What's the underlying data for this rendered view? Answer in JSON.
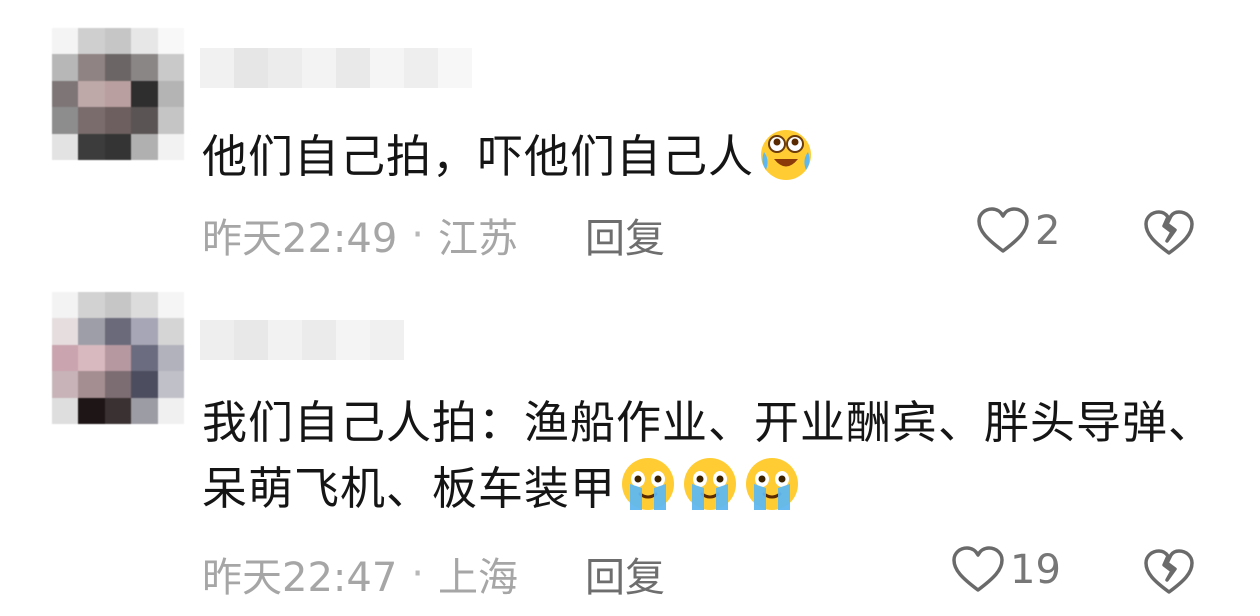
{
  "comments": [
    {
      "text": "他们自己拍，吓他们自己人",
      "emojis": [
        "laugh-cry-icon"
      ],
      "time": "昨天22:49",
      "location": "江苏",
      "reply_label": "回复",
      "likes": "2"
    },
    {
      "text": "我们自己人拍：渔船作业、开业酬宾、胖头导弹、呆萌飞机、板车装甲",
      "emojis": [
        "crying-face-icon",
        "crying-face-icon",
        "crying-face-icon"
      ],
      "time": "昨天22:47",
      "location": "上海",
      "reply_label": "回复",
      "likes": "19"
    }
  ],
  "separator": "·",
  "colors": {
    "text": "#151515",
    "meta": "#a6a6a6",
    "reply": "#6e6e6e",
    "icon_stroke": "#6a6a6a",
    "emoji_yellow": "#ffcc33",
    "emoji_tear": "#5fb7f0"
  }
}
